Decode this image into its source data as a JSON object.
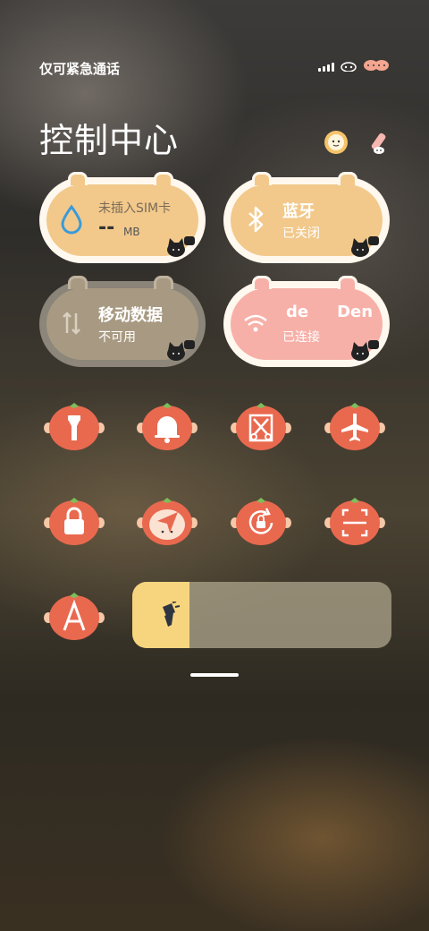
{
  "status_bar": {
    "carrier_text": "仅可紧急通话"
  },
  "header": {
    "title": "控制中心",
    "left_icon": "sun-face-icon",
    "right_icon": "edit-pen-icon"
  },
  "tiles": {
    "data_usage": {
      "title": "未插入SIM卡",
      "value": "--",
      "unit": "MB"
    },
    "bluetooth": {
      "title": "蓝牙",
      "status": "已关闭"
    },
    "mobile_data": {
      "title": "移动数据",
      "status": "不可用"
    },
    "wifi": {
      "title": "de Den",
      "title_a": "de",
      "title_b": "Den",
      "status": "已连接"
    }
  },
  "toggles": [
    "flashlight-icon",
    "bell-icon",
    "screenshot-scissors-icon",
    "airplane-icon",
    "lock-icon",
    "location-arrow-icon",
    "rotation-lock-icon",
    "scan-icon",
    "font-a-icon"
  ],
  "brightness": {
    "level": 0.22
  },
  "colors": {
    "tile_yellow": "#f2c98b",
    "tile_pink": "#f7b0a8",
    "tile_gray": "#a8a090",
    "tomato": "#e9694f",
    "brightness_fill": "#f7d57e"
  }
}
